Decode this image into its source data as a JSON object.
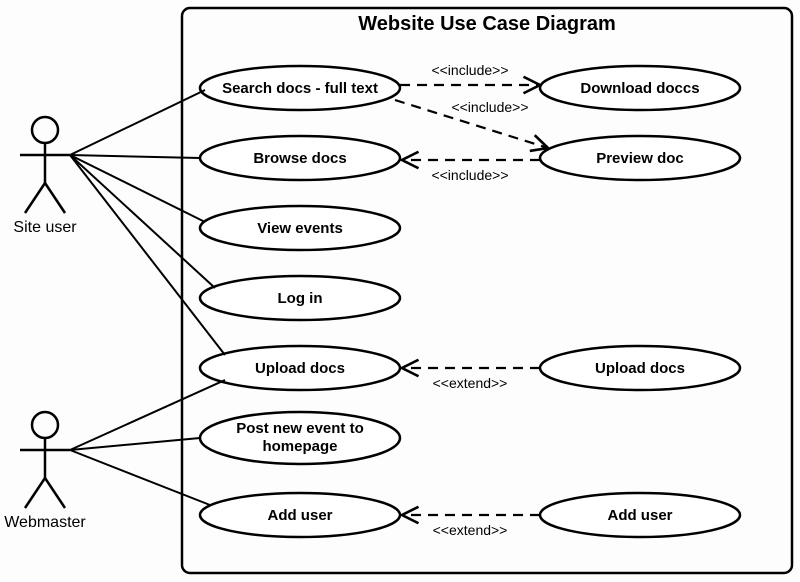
{
  "title": "Website Use Case Diagram",
  "actors": {
    "site_user": "Site user",
    "webmaster": "Webmaster"
  },
  "use_cases": {
    "search": "Search docs - full text",
    "browse": "Browse docs",
    "view_events": "View events",
    "log_in": "Log in",
    "upload_left": "Upload docs",
    "post_event": "Post new event to homepage",
    "add_user_left": "Add user",
    "download": "Download doccs",
    "preview": "Preview doc",
    "upload_right": "Upload docs",
    "add_user_right": "Add user"
  },
  "stereotypes": {
    "include": "<<include>>",
    "extend": "<<extend>>"
  }
}
